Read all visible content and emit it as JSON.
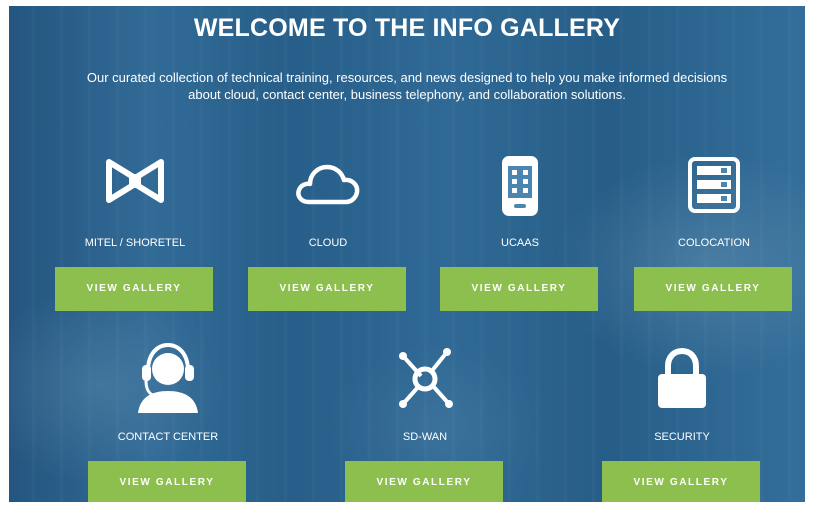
{
  "header": {
    "title": "WELCOME TO THE INFO GALLERY",
    "subtitle_line1": "Our curated collection of technical training, resources, and news designed to help you make informed decisions",
    "subtitle_line2": "about cloud, contact center, business telephony, and collaboration solutions."
  },
  "galleries": [
    {
      "label": "MITEL / SHORETEL",
      "icon": "mitel-logo-icon",
      "button": "VIEW GALLERY"
    },
    {
      "label": "CLOUD",
      "icon": "cloud-icon",
      "button": "VIEW GALLERY"
    },
    {
      "label": "UCAAS",
      "icon": "phone-icon",
      "button": "VIEW GALLERY"
    },
    {
      "label": "COLOCATION",
      "icon": "server-icon",
      "button": "VIEW GALLERY"
    },
    {
      "label": "CONTACT CENTER",
      "icon": "headset-agent-icon",
      "button": "VIEW GALLERY"
    },
    {
      "label": "SD-WAN",
      "icon": "network-hub-icon",
      "button": "VIEW GALLERY"
    },
    {
      "label": "SECURITY",
      "icon": "lock-icon",
      "button": "VIEW GALLERY"
    }
  ],
  "colors": {
    "button": "#8cbf4d",
    "background": "#2e6994",
    "text": "#ffffff"
  }
}
